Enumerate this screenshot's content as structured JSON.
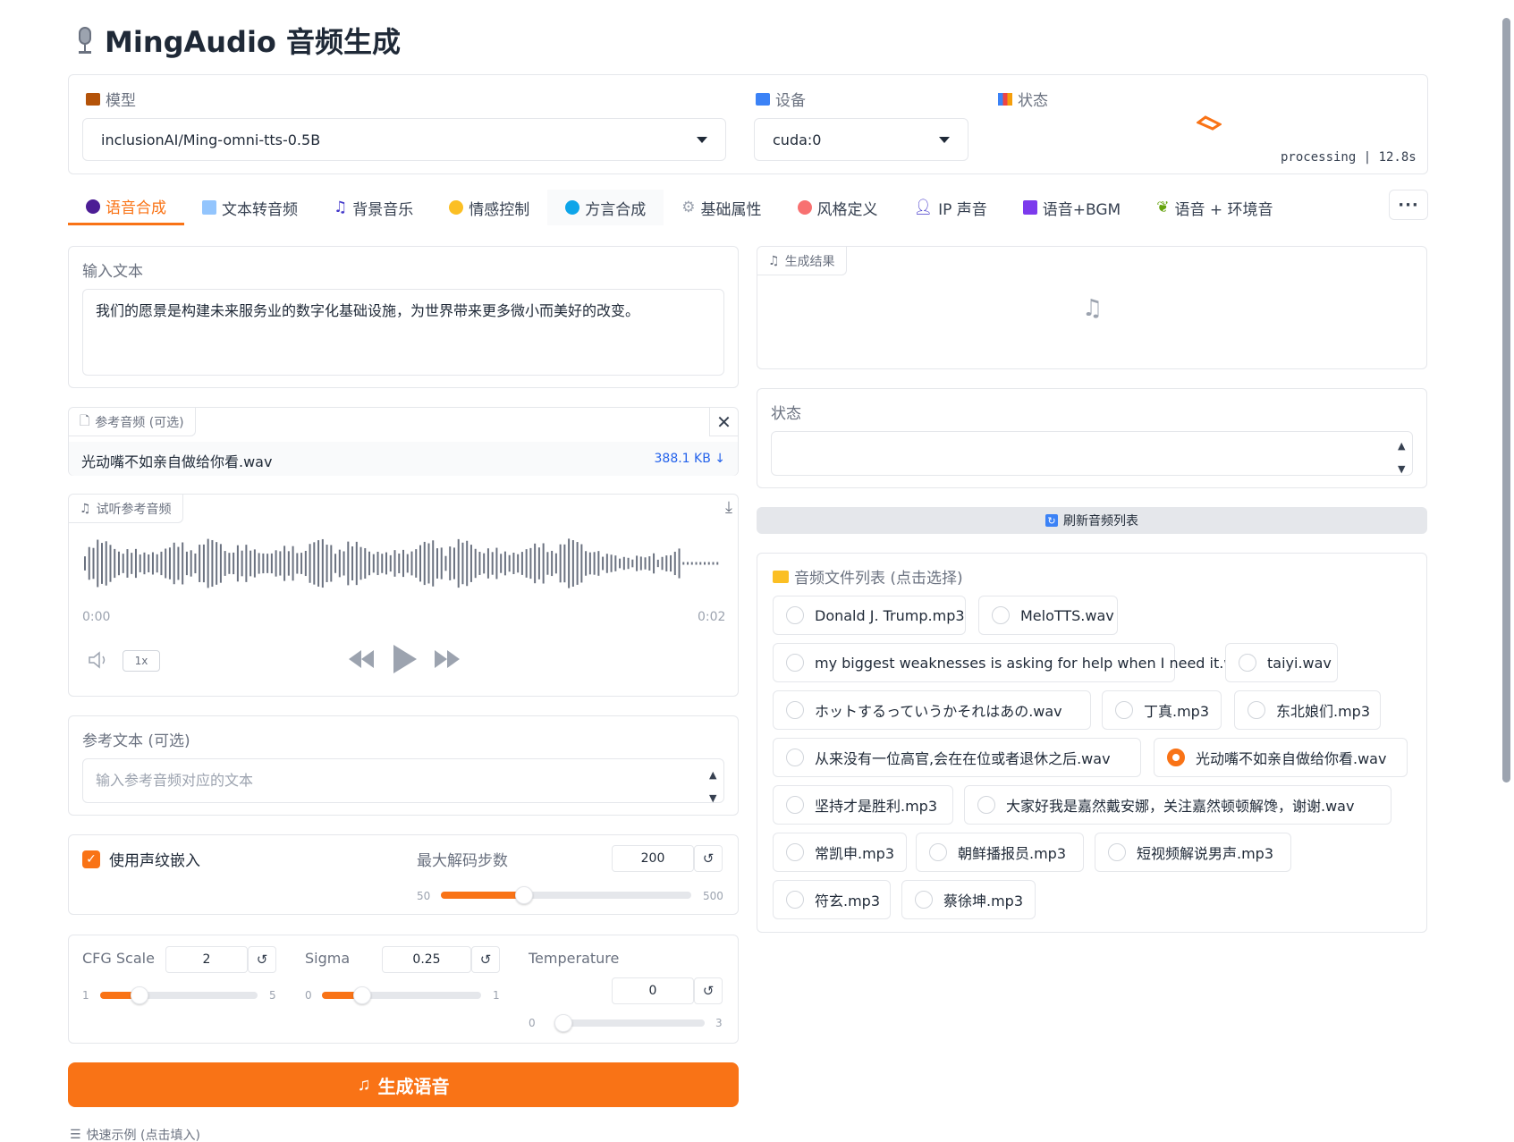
{
  "header": {
    "title": "MingAudio 音频生成"
  },
  "config": {
    "model_label": "模型",
    "model_value": "inclusionAI/Ming-omni-tts-0.5B",
    "device_label": "设备",
    "device_value": "cuda:0",
    "status_label": "状态",
    "status_text": "processing | 12.8s"
  },
  "tabs": [
    {
      "label": "语音合成",
      "icon": "speaking-head-icon"
    },
    {
      "label": "文本转音频",
      "icon": "speaker-icon"
    },
    {
      "label": "背景音乐",
      "icon": "music-note-icon"
    },
    {
      "label": "情感控制",
      "icon": "smiley-icon"
    },
    {
      "label": "方言合成",
      "icon": "globe-icon"
    },
    {
      "label": "基础属性",
      "icon": "gear-icon"
    },
    {
      "label": "风格定义",
      "icon": "palette-icon"
    },
    {
      "label": "IP 声音",
      "icon": "person-icon"
    },
    {
      "label": "语音+BGM",
      "icon": "instrument-icon"
    },
    {
      "label": "语音 + 环境音",
      "icon": "leaf-icon"
    }
  ],
  "more_tabs": "···",
  "input_text": {
    "label": "输入文本",
    "value": "我们的愿景是构建未来服务业的数字化基础设施，为世界带来更多微小而美好的改变。"
  },
  "ref_audio": {
    "label": "参考音频 (可选)",
    "filename": "光动嘴不如亲自做给你看.wav",
    "size": "388.1 KB ↓"
  },
  "preview": {
    "label": "试听参考音频",
    "time_start": "0:00",
    "time_end": "0:02",
    "speed": "1x"
  },
  "ref_text": {
    "label": "参考文本 (可选)",
    "placeholder": "输入参考音频对应的文本"
  },
  "voiceprint": {
    "label": "使用声纹嵌入",
    "checked": true
  },
  "max_steps": {
    "label": "最大解码步数",
    "value": "200",
    "min": "50",
    "max": "500",
    "fraction": 0.333
  },
  "cfg": {
    "label": "CFG Scale",
    "value": "2",
    "min": "1",
    "max": "5",
    "fraction": 0.25
  },
  "sigma": {
    "label": "Sigma",
    "value": "0.25",
    "min": "0",
    "max": "1",
    "fraction": 0.25
  },
  "temperature": {
    "label": "Temperature",
    "value": "0",
    "min": "0",
    "max": "3",
    "fraction": 0.0
  },
  "generate_label": "生成语音",
  "quick_examples": "快速示例 (点击填入)",
  "result": {
    "label": "生成结果"
  },
  "status_box": {
    "label": "状态",
    "value": ""
  },
  "refresh_label": "刷新音频列表",
  "file_list": {
    "label": "音频文件列表 (点击选择)",
    "selected": "光动嘴不如亲自做给你看.wav",
    "items": [
      "Donald J. Trump.mp3",
      "MeloTTS.wav",
      "my biggest weaknesses is asking for help when I need it.wav",
      "taiyi.wav",
      "ホットするっていうかそれはあの.wav",
      "丁真.mp3",
      "东北娘们.mp3",
      "从来没有一位高官,会在在位或者退休之后.wav",
      "光动嘴不如亲自做给你看.wav",
      "坚持才是胜利.mp3",
      "大家好我是嘉然戴安娜，关注嘉然顿顿解馋，谢谢.wav",
      "常凯申.mp3",
      "朝鲜播报员.mp3",
      "短视频解说男声.mp3",
      "符玄.mp3",
      "蔡徐坤.mp3"
    ]
  },
  "colors": {
    "accent": "#f97316",
    "border": "#e5e7eb"
  }
}
